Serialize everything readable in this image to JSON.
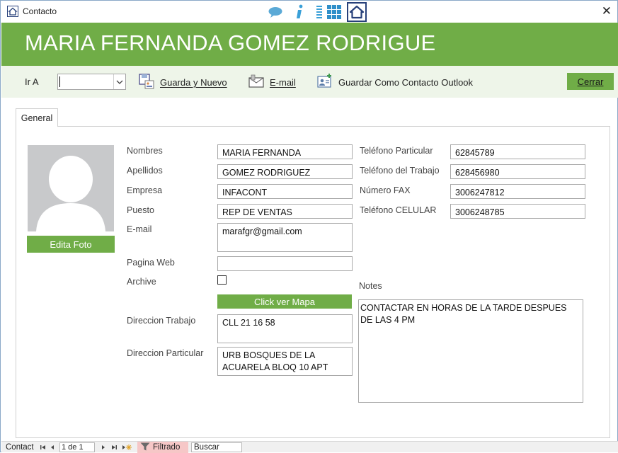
{
  "window": {
    "title": "Contacto",
    "close_glyph": "✕"
  },
  "header": {
    "name": "MARIA FERNANDA GOMEZ RODRIGUE"
  },
  "toolbar": {
    "ir_a_label": "Ir A",
    "ir_a_value": "",
    "guarda_nuevo": "Guarda y Nuevo",
    "email": "E-mail",
    "guardar_outlook": "Guardar Como Contacto Outlook",
    "cerrar": "Cerrar"
  },
  "tabs": [
    {
      "label": "General"
    }
  ],
  "photo": {
    "edit_label": "Edita Foto"
  },
  "form": {
    "nombres": {
      "label": "Nombres",
      "value": "MARIA FERNANDA"
    },
    "apellidos": {
      "label": "Apellidos",
      "value": "GOMEZ RODRIGUEZ"
    },
    "empresa": {
      "label": "Empresa",
      "value": "INFACONT"
    },
    "puesto": {
      "label": "Puesto",
      "value": "REP DE VENTAS"
    },
    "email": {
      "label": "E-mail",
      "value": "marafgr@gmail.com"
    },
    "pagina_web": {
      "label": "Pagina Web",
      "value": ""
    },
    "archive": {
      "label": "Archive",
      "checked": false
    },
    "ver_mapa": "Click ver Mapa",
    "direccion_trabajo": {
      "label": "Direccion Trabajo",
      "value": "CLL 21 16 58"
    },
    "direccion_particular": {
      "label": "Direccion Particular",
      "value": "URB BOSQUES DE LA\nACUARELA BLOQ 10 APT"
    },
    "tel_particular": {
      "label": "Teléfono Particular",
      "value": "62845789"
    },
    "tel_trabajo": {
      "label": "Teléfono del Trabajo",
      "value": "628456980"
    },
    "fax": {
      "label": "Número FAX",
      "value": "3006247812"
    },
    "celular": {
      "label": "Teléfono CELULAR",
      "value": "3006248785"
    },
    "notes": {
      "label": "Notes",
      "value": "CONTACTAR EN HORAS DE LA TARDE DESPUES\nDE LAS 4 PM"
    }
  },
  "statusbar": {
    "record_label": "Contact",
    "record_position": "1 de 1",
    "filter_label": "Filtrado",
    "search_label": "Buscar"
  },
  "colors": {
    "accent_green": "#70ad47",
    "toolbar_bg": "#eef5e9",
    "filter_bg": "#f6c7c7"
  },
  "icons": [
    "app-home-icon",
    "chat-bubble-icon",
    "info-icon",
    "list-icon",
    "grid-icon",
    "home-icon",
    "close-icon",
    "save-new-icon",
    "email-icon",
    "outlook-contact-icon",
    "chevron-down-icon",
    "filter-icon"
  ]
}
